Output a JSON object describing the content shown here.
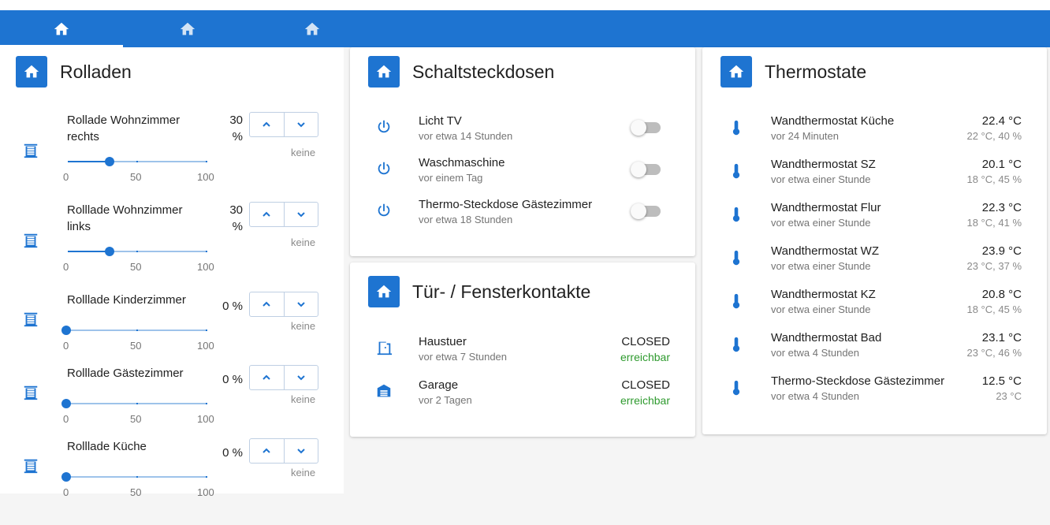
{
  "tabs": [
    {
      "icon": "home-icon"
    },
    {
      "icon": "home-icon"
    },
    {
      "icon": "home-icon"
    }
  ],
  "rolladen": {
    "title": "Rolladen",
    "scale": [
      "0",
      "50",
      "100"
    ],
    "button_status": "keine",
    "items": [
      {
        "name": "Rollade Wohnzimmer rechts",
        "percent_label": "30 %",
        "value": 30
      },
      {
        "name": "Rolllade Wohnzimmer links",
        "percent_label": "30 %",
        "value": 30
      },
      {
        "name": "Rolllade Kinderzimmer",
        "percent_label": "0 %",
        "value": 0
      },
      {
        "name": "Rolllade Gästezimmer",
        "percent_label": "0 %",
        "value": 0
      },
      {
        "name": "Rolllade Küche",
        "percent_label": "0 %",
        "value": 0
      }
    ]
  },
  "steckdosen": {
    "title": "Schaltsteckdosen",
    "items": [
      {
        "name": "Licht TV",
        "time": "vor etwa 14 Stunden",
        "on": false
      },
      {
        "name": "Waschmaschine",
        "time": "vor einem Tag",
        "on": false
      },
      {
        "name": "Thermo-Steckdose Gästezimmer",
        "time": "vor etwa 18 Stunden",
        "on": false
      }
    ]
  },
  "kontakte": {
    "title": "Tür- / Fensterkontakte",
    "items": [
      {
        "name": "Haustuer",
        "time": "vor etwa 7 Stunden",
        "state": "CLOSED",
        "status": "erreichbar",
        "icon": "door-icon"
      },
      {
        "name": "Garage",
        "time": "vor 2 Tagen",
        "state": "CLOSED",
        "status": "erreichbar",
        "icon": "garage-icon"
      }
    ]
  },
  "thermostate": {
    "title": "Thermostate",
    "items": [
      {
        "name": "Wandthermostat Küche",
        "time": "vor 24 Minuten",
        "temp": "22.4 °C",
        "detail": "22 °C, 40 %"
      },
      {
        "name": "Wandthermostat SZ",
        "time": "vor etwa einer Stunde",
        "temp": "20.1 °C",
        "detail": "18 °C, 45 %"
      },
      {
        "name": "Wandthermostat Flur",
        "time": "vor etwa einer Stunde",
        "temp": "22.3 °C",
        "detail": "18 °C, 41 %"
      },
      {
        "name": "Wandthermostat WZ",
        "time": "vor etwa einer Stunde",
        "temp": "23.9 °C",
        "detail": "23 °C, 37 %"
      },
      {
        "name": "Wandthermostat KZ",
        "time": "vor etwa einer Stunde",
        "temp": "20.8 °C",
        "detail": "18 °C, 45 %"
      },
      {
        "name": "Wandthermostat Bad",
        "time": "vor etwa 4 Stunden",
        "temp": "23.1 °C",
        "detail": "23 °C, 46 %"
      },
      {
        "name": "Thermo-Steckdose Gästezimmer",
        "time": "vor etwa 4 Stunden",
        "temp": "12.5 °C",
        "detail": "23 °C"
      }
    ]
  },
  "colors": {
    "accent": "#1e74d1",
    "reachable": "#2e9a2e"
  }
}
